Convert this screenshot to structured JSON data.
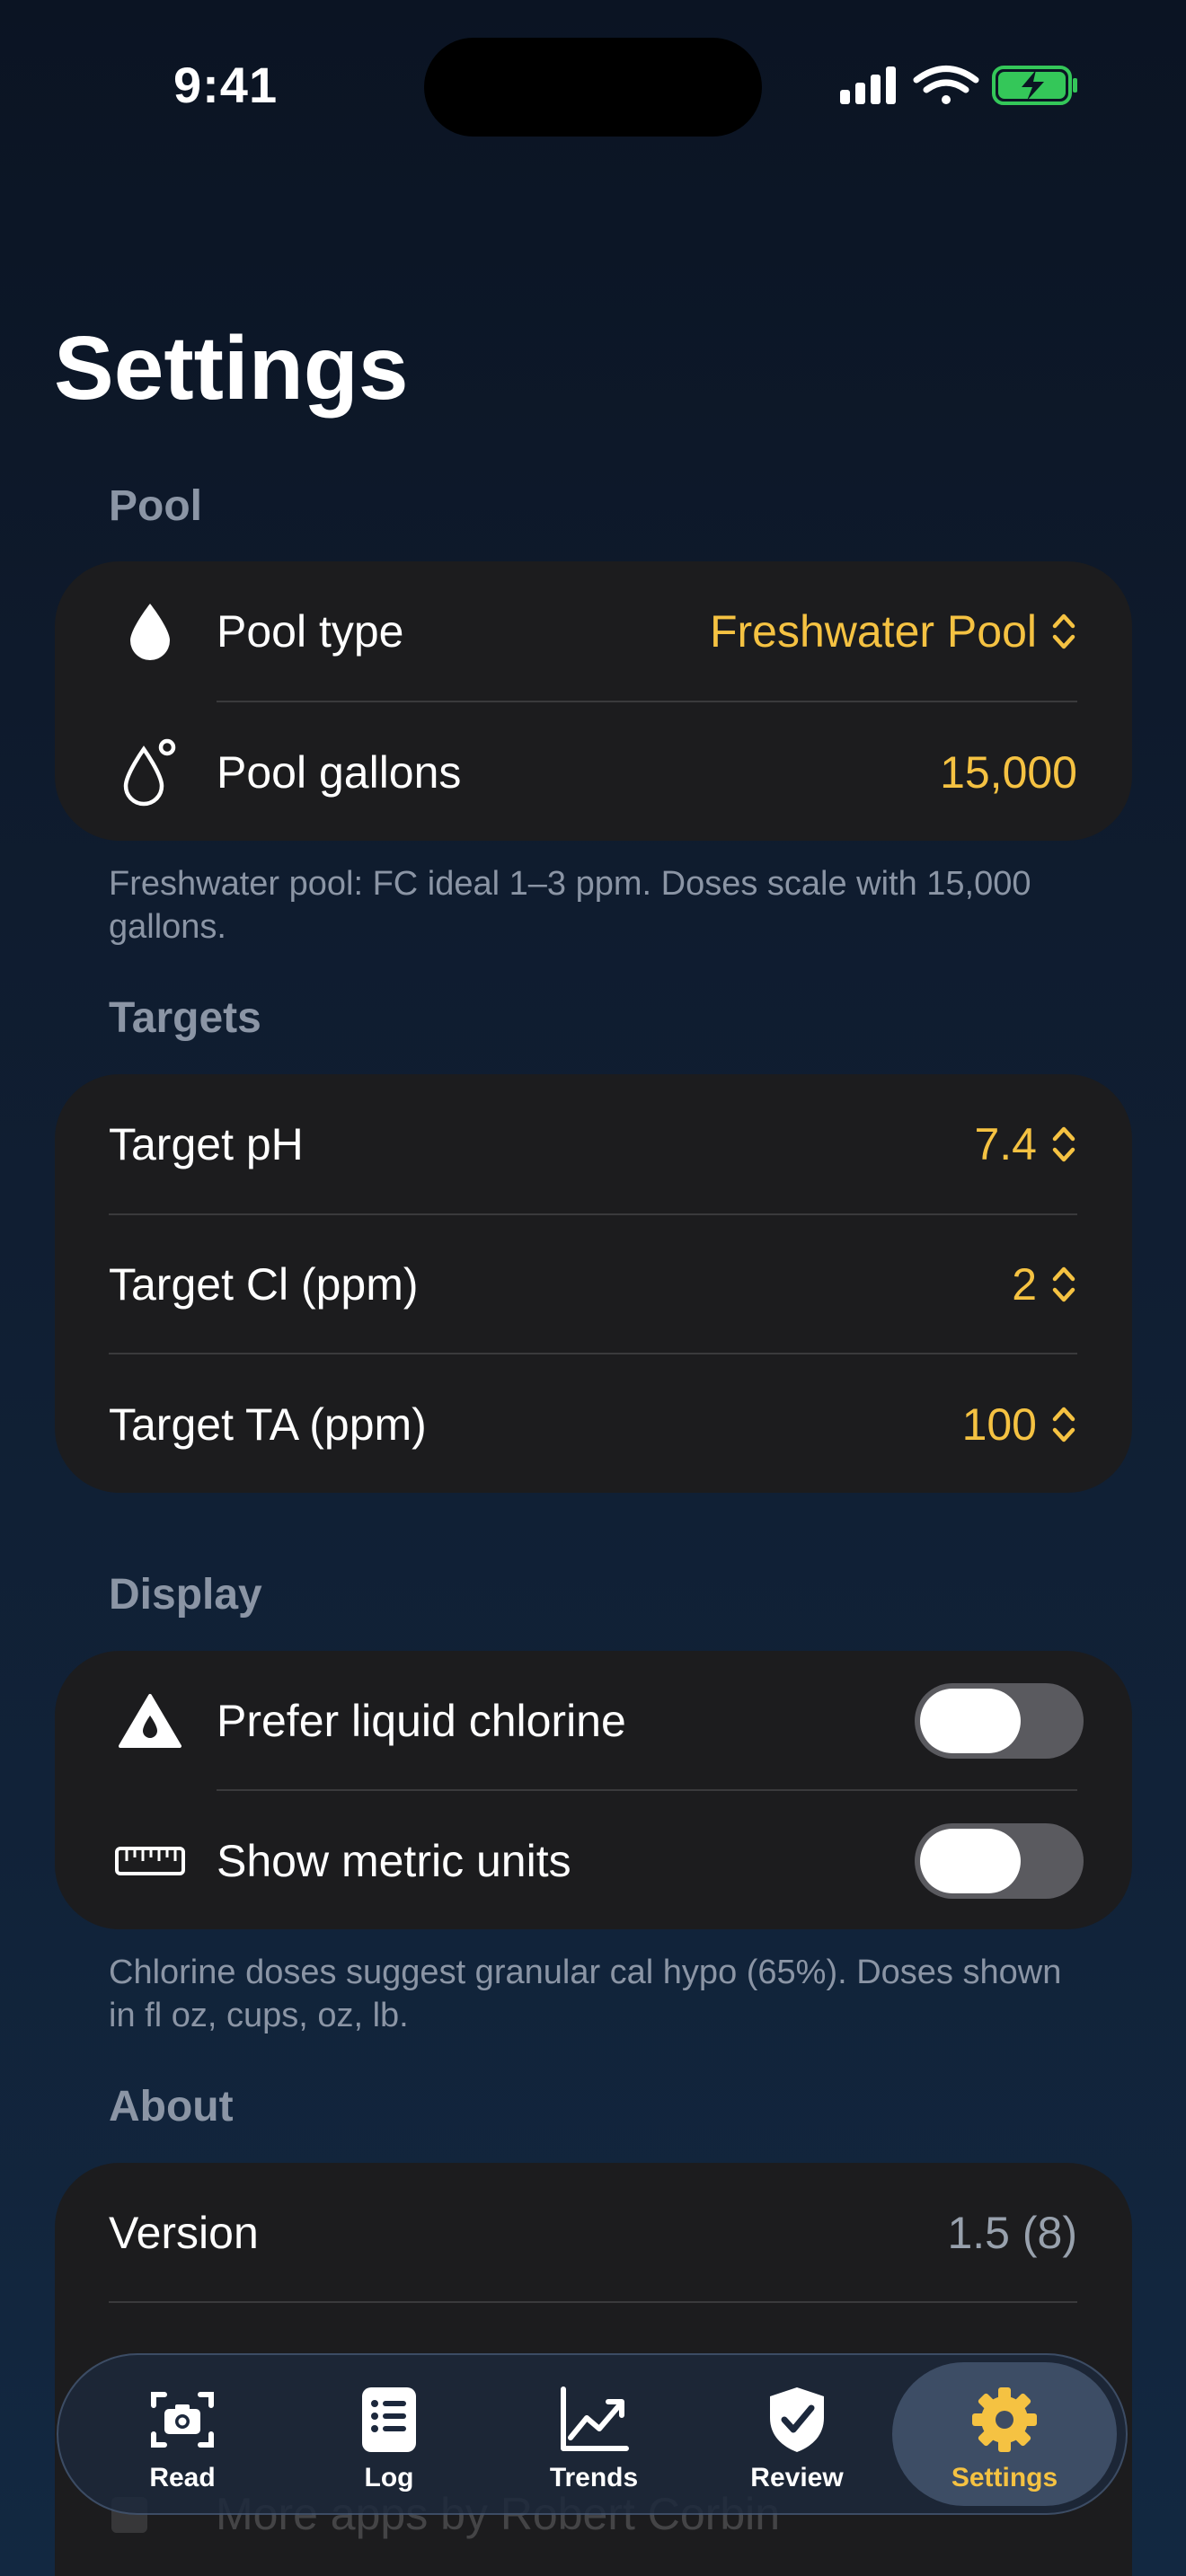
{
  "status_bar": {
    "time": "9:41"
  },
  "page": {
    "title": "Settings"
  },
  "pool": {
    "header": "Pool",
    "pool_type_label": "Pool type",
    "pool_type_value": "Freshwater Pool",
    "pool_gallons_label": "Pool gallons",
    "pool_gallons_value": "15,000",
    "footnote": "Freshwater pool: FC ideal 1–3 ppm. Doses scale with 15,000 gallons."
  },
  "targets": {
    "header": "Targets",
    "ph_label": "Target pH",
    "ph_value": "7.4",
    "cl_label": "Target Cl (ppm)",
    "cl_value": "2",
    "ta_label": "Target TA (ppm)",
    "ta_value": "100"
  },
  "display": {
    "header": "Display",
    "liquid_chlorine_label": "Prefer liquid chlorine",
    "liquid_chlorine_on": false,
    "metric_label": "Show metric units",
    "metric_on": false,
    "footnote": "Chlorine doses suggest granular cal hypo (65%). Doses shown in fl oz, cups, oz, lb."
  },
  "about": {
    "header": "About",
    "version_label": "Version",
    "version_value": "1.5 (8)",
    "more_apps_label": "More apps by Robert Corbin"
  },
  "tab_bar": {
    "tabs": [
      {
        "label": "Read",
        "icon": "camera-icon"
      },
      {
        "label": "Log",
        "icon": "list-icon"
      },
      {
        "label": "Trends",
        "icon": "chart-icon"
      },
      {
        "label": "Review",
        "icon": "shield-check-icon"
      },
      {
        "label": "Settings",
        "icon": "gear-icon"
      }
    ],
    "active": "Settings"
  },
  "colors": {
    "accent": "#f5c242",
    "card": "#1c1c1e",
    "secondary_text": "#8b95a5",
    "battery": "#34c759"
  }
}
